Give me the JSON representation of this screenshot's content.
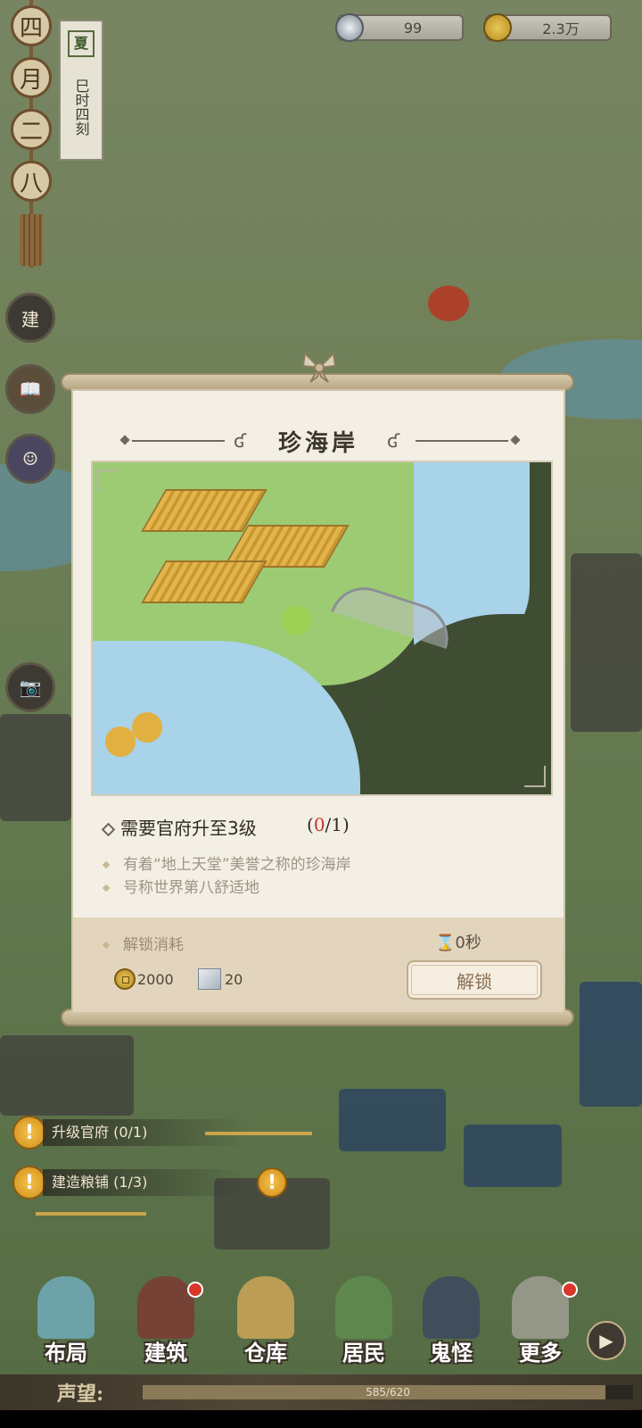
{
  "top_bar": {
    "silver": {
      "icon": "silver-ingot-icon",
      "value": "99"
    },
    "copper": {
      "icon": "copper-coin-icon",
      "value": "2.3万"
    }
  },
  "calendar": {
    "beads": [
      "四",
      "月",
      "二",
      "八"
    ],
    "season": "夏",
    "time": "巳时四刻"
  },
  "side_buttons": [
    {
      "name": "build-sign-button",
      "label": "建"
    },
    {
      "name": "book-button",
      "label": ""
    },
    {
      "name": "character-button",
      "label": ""
    },
    {
      "name": "camera-button",
      "label": ""
    }
  ],
  "modal": {
    "title": "珍海岸",
    "requirement": {
      "text": "需要官府升至3级",
      "open": "(",
      "current": "0",
      "total": "/1)"
    },
    "descriptions": [
      "有着“地上天堂”美誉之称的珍海岸",
      "号称世界第八舒适地"
    ],
    "cost": {
      "label": "解锁消耗",
      "time": "0秒",
      "coins": "2000",
      "stone": "20",
      "unlock_button": "解锁"
    }
  },
  "quests": [
    {
      "label": "升级官府 (0/1)",
      "icon": "exclamation-icon",
      "progress": 0
    },
    {
      "label": "建造粮铺 (1/3)",
      "icon": "exclamation-icon",
      "progress": 0.33
    }
  ],
  "nav": [
    {
      "label": "布局",
      "dot": false
    },
    {
      "label": "建筑",
      "dot": true
    },
    {
      "label": "仓库",
      "dot": false
    },
    {
      "label": "居民",
      "dot": false
    },
    {
      "label": "鬼怪",
      "dot": false
    },
    {
      "label": "更多",
      "dot": true
    }
  ],
  "reputation": {
    "label": "声望:",
    "value": "585/620",
    "fraction": 0.944
  },
  "colors": {
    "accent": "#c8322a",
    "gold": "#d9a42a",
    "panel": "#f3efe4"
  }
}
